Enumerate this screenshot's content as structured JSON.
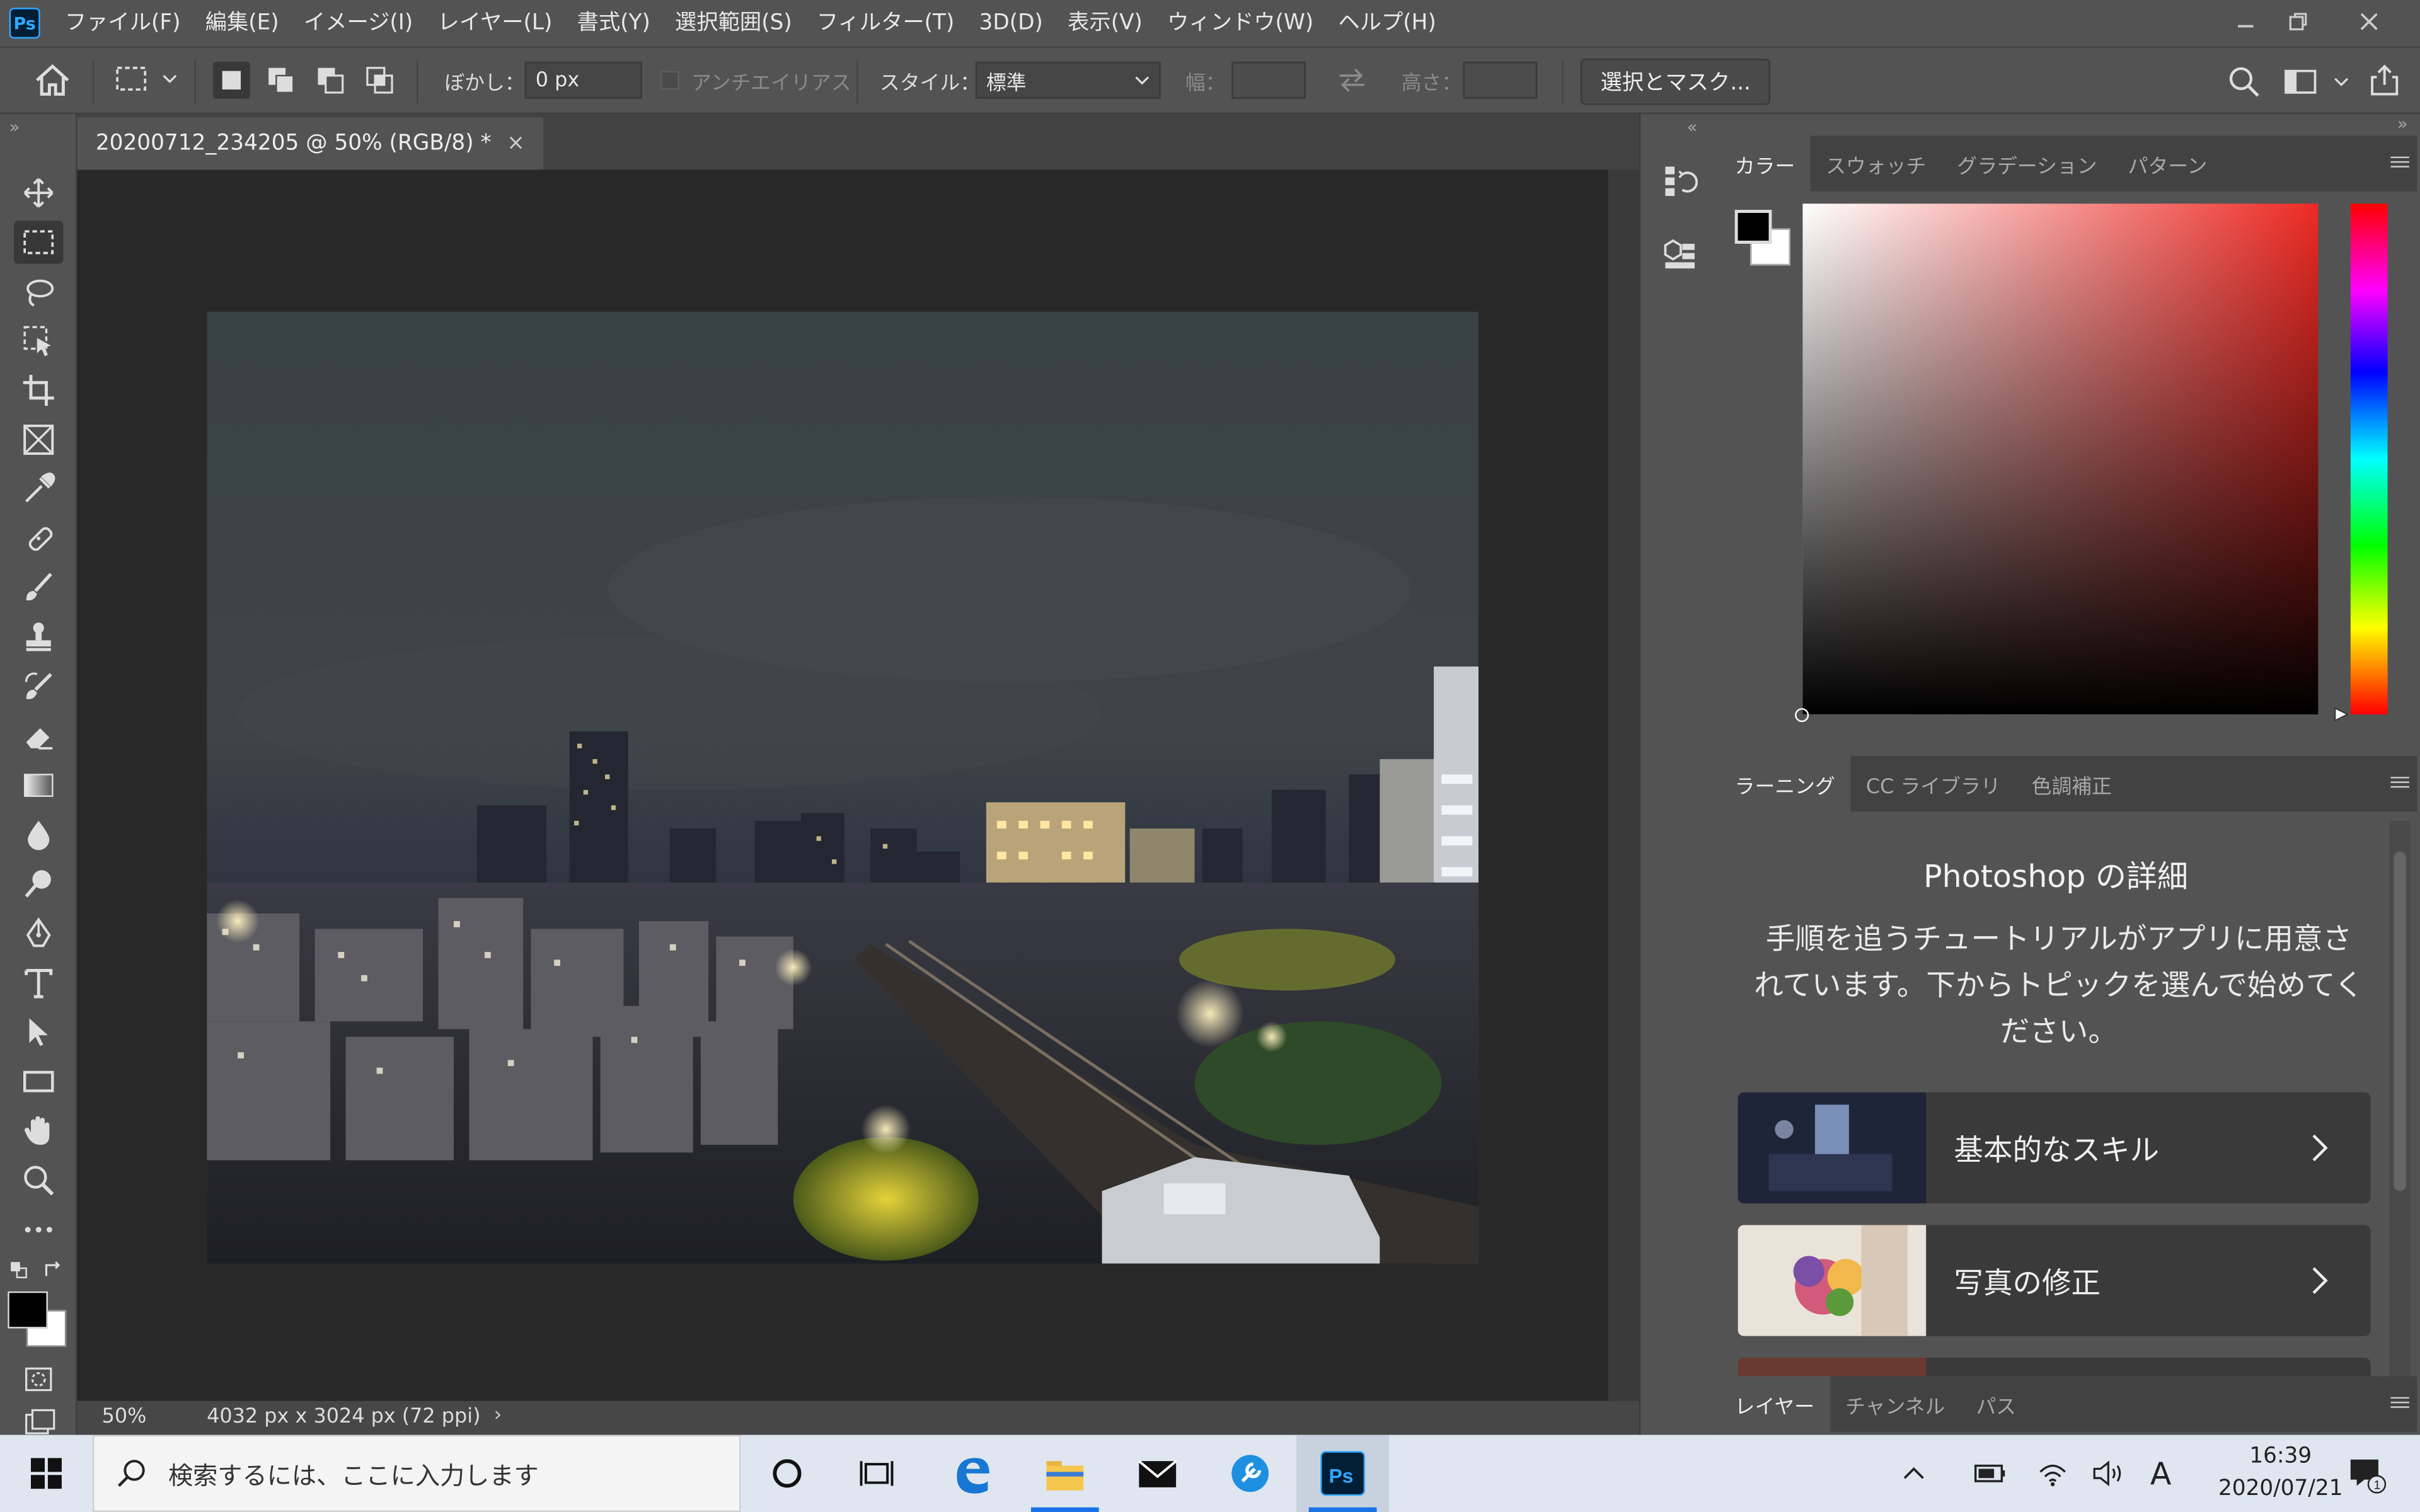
{
  "app": {
    "logo": "Ps",
    "menu": [
      "ファイル(F)",
      "編集(E)",
      "イメージ(I)",
      "レイヤー(L)",
      "書式(Y)",
      "選択範囲(S)",
      "フィルター(T)",
      "3D(D)",
      "表示(V)",
      "ウィンドウ(W)",
      "ヘルプ(H)"
    ]
  },
  "options": {
    "feather_label": "ぼかし：",
    "feather_value": "0 px",
    "antialias_label": "アンチエイリアス",
    "style_label": "スタイル：",
    "style_value": "標準",
    "width_label": "幅：",
    "height_label": "高さ：",
    "mask_button": "選択とマスク..."
  },
  "document": {
    "tab_title": "20200712_234205 @ 50% (RGB/8) *",
    "zoom": "50%",
    "info": "4032 px x 3024 px (72 ppi)"
  },
  "color_panel": {
    "tabs": [
      "カラー",
      "スウォッチ",
      "グラデーション",
      "パターン"
    ],
    "active_tab": 0,
    "hue_color": "#ee2a24"
  },
  "learn_panel": {
    "tabs": [
      "ラーニング",
      "CC ライブラリ",
      "色調補正"
    ],
    "active_tab": 0,
    "title": "Photoshop の詳細",
    "description": "手順を追うチュートリアルがアプリに用意されています。下からトピックを選んで始めてください。",
    "cards": [
      "基本的なスキル",
      "写真の修正"
    ]
  },
  "layers_panel": {
    "tabs": [
      "レイヤー",
      "チャンネル",
      "パス"
    ],
    "active_tab": 0
  },
  "taskbar": {
    "search_placeholder": "検索するには、ここに入力します",
    "time": "16:39",
    "date": "2020/07/21",
    "notification_count": "1",
    "ime": "A"
  },
  "icons": [
    "home-icon",
    "marquee-icon",
    "move-icon",
    "lasso-icon",
    "crop-icon",
    "eyedropper-icon",
    "brush-icon",
    "text-icon",
    "hand-icon",
    "zoom-icon",
    "search-icon",
    "share-icon",
    "windows-start-icon",
    "edge-icon",
    "folder-icon",
    "mail-icon",
    "photoshop-taskbar-icon"
  ]
}
